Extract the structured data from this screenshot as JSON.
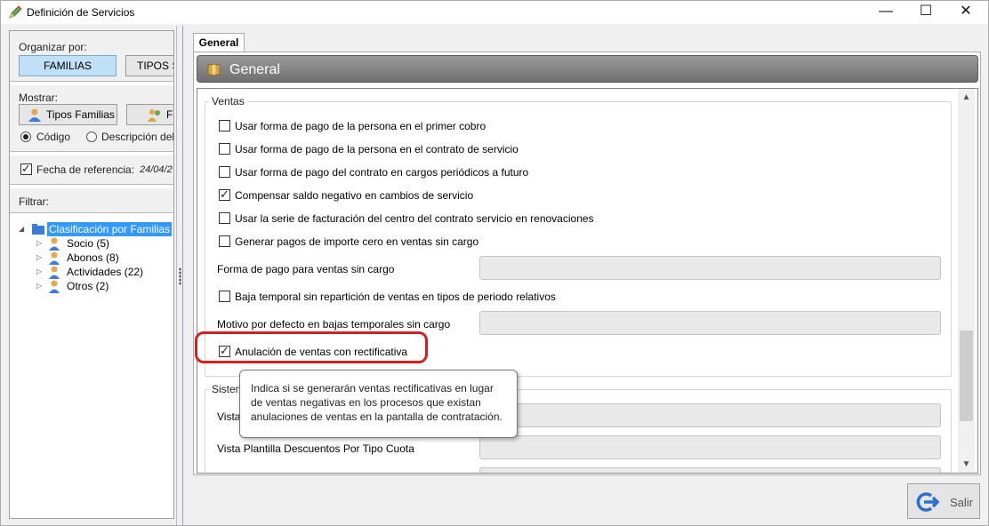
{
  "window": {
    "title": "Definición de Servicios",
    "minimize": "—",
    "maximize": "☐",
    "close": "✕"
  },
  "left": {
    "organizar_label": "Organizar por:",
    "organizar_buttons": [
      "FAMILIAS",
      "TIPOS S"
    ],
    "mostrar_label": "Mostrar:",
    "mostrar_buttons": [
      "Tipos Familias",
      "F"
    ],
    "radio_codigo": "Código",
    "radio_descripcion": "Descripción del",
    "fecha_label": "Fecha de referencia:",
    "fecha_value": "24/04/2",
    "filtrar_label": "Filtrar:",
    "tree": {
      "root": "Clasificación por Familias",
      "children": [
        "Socio (5)",
        "Abonos (8)",
        "Actividades (22)",
        "Otros (2)"
      ]
    }
  },
  "tab": {
    "label": "General"
  },
  "header": {
    "title": "General"
  },
  "ventas": {
    "legend": "Ventas",
    "options": [
      {
        "label": "Usar forma de pago de la persona en el primer cobro",
        "checked": false
      },
      {
        "label": "Usar forma de pago de la persona en el contrato de servicio",
        "checked": false
      },
      {
        "label": "Usar forma de pago del contrato en cargos periódicos a futuro",
        "checked": false
      },
      {
        "label": "Compensar saldo negativo en cambios de servicio",
        "checked": true
      },
      {
        "label": "Usar la serie de facturación del centro del contrato servicio en renovaciones",
        "checked": false
      },
      {
        "label": "Generar pagos de importe cero en ventas sin cargo",
        "checked": false
      }
    ],
    "forma_pago_label": "Forma de pago para ventas sin cargo",
    "baja_temporal_label": "Baja temporal sin repartición de ventas en tipos de periodo relativos",
    "motivo_label": "Motivo por defecto en bajas temporales sin cargo",
    "anulacion_label": "Anulación de ventas con rectificativa"
  },
  "sistema": {
    "legend": "Sistema",
    "vista_label": "Vista",
    "vista_plantilla_label": "Vista Plantilla Descuentos Por Tipo Cuota"
  },
  "tooltip": {
    "text": "Indica si se generarán ventas rectificativas en lugar de ventas negativas en los procesos que existan anulaciones de ventas en la pantalla de contratación."
  },
  "salir": {
    "label": "Salir"
  }
}
